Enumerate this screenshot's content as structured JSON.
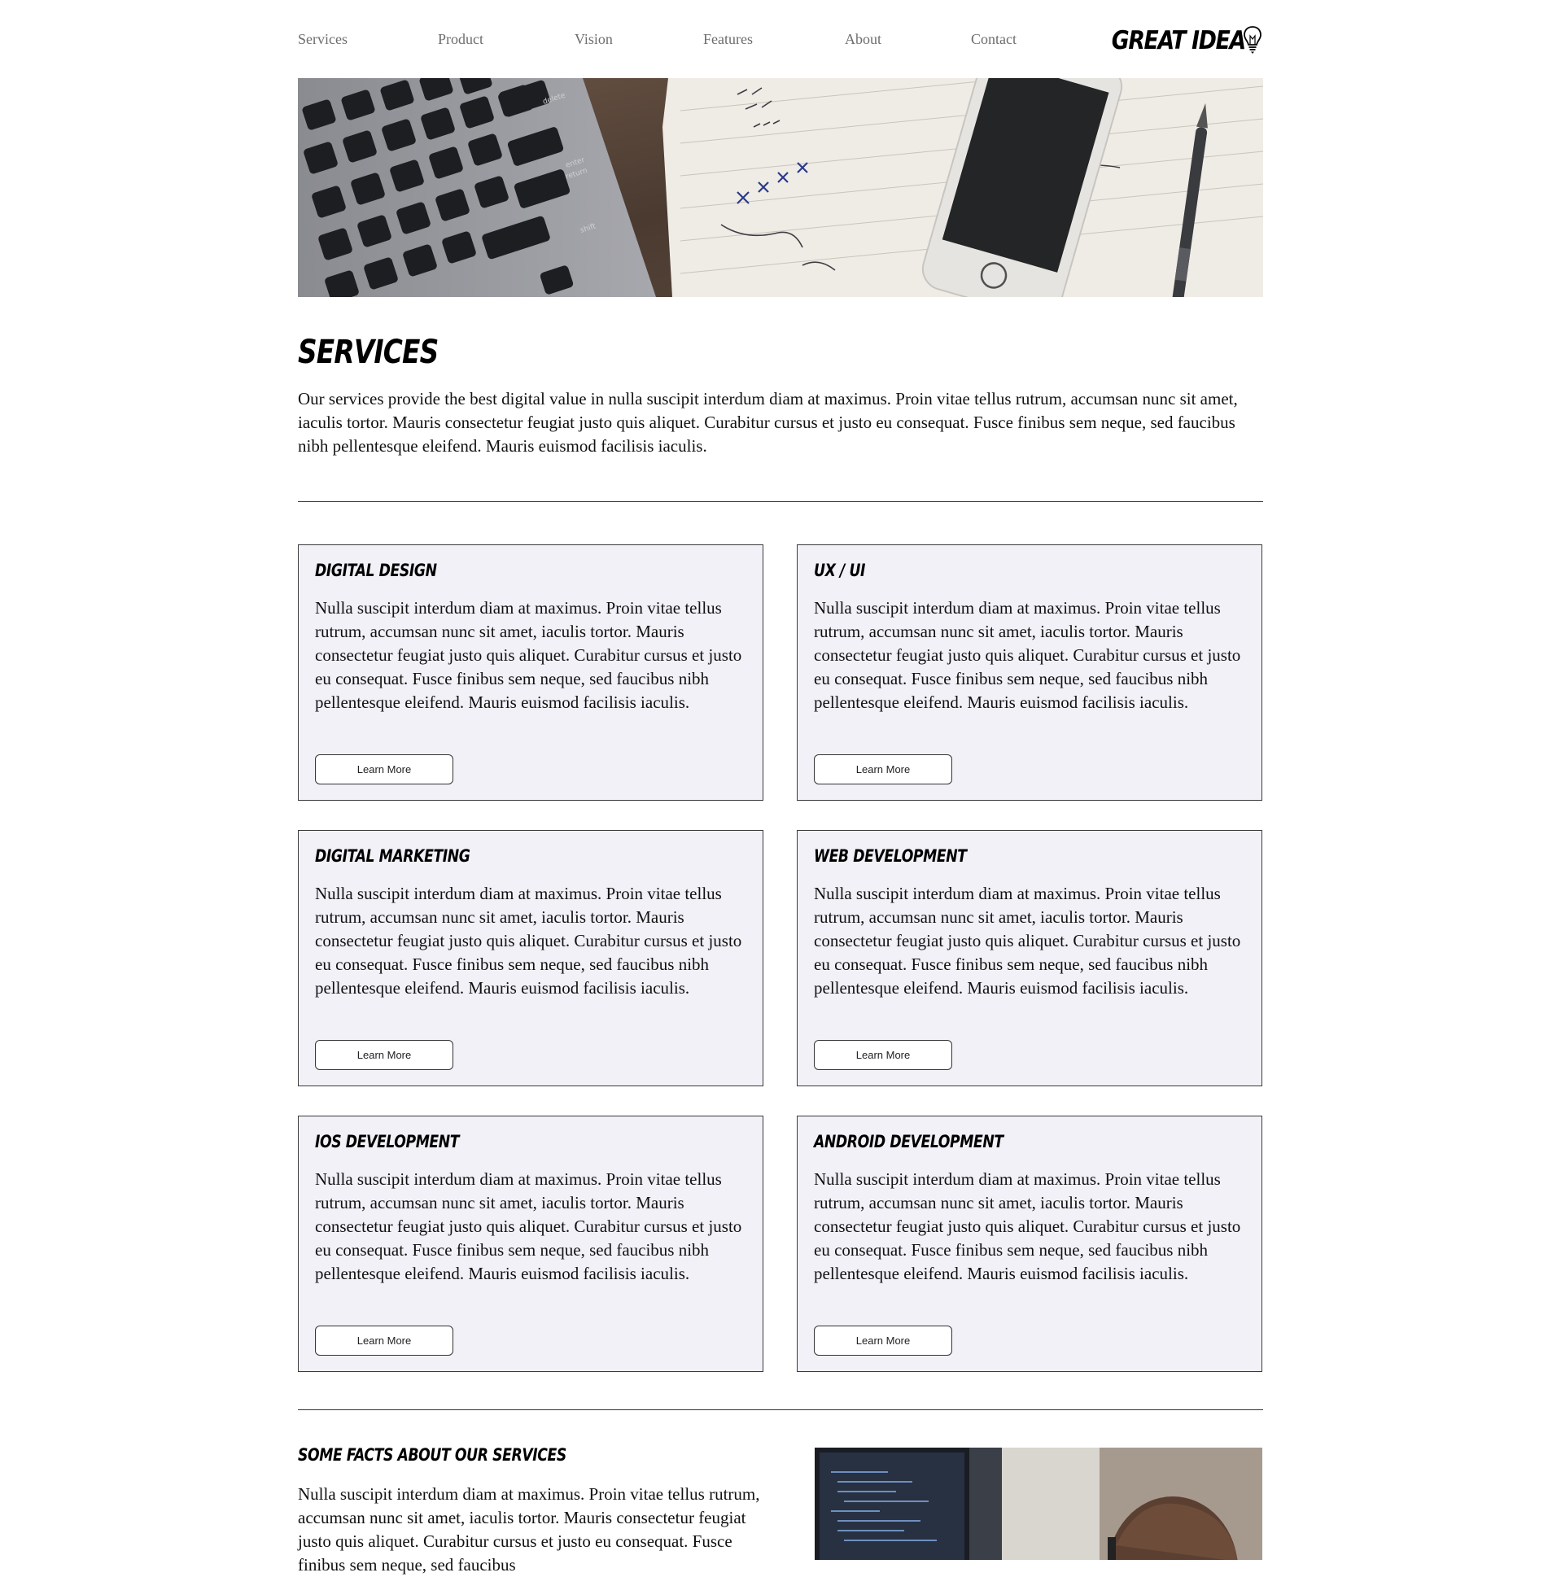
{
  "nav": {
    "items": [
      "Services",
      "Product",
      "Vision",
      "Features",
      "About",
      "Contact"
    ],
    "logo_text": "GREAT IDEA"
  },
  "hero": {
    "keyboard_keys": [
      "delete",
      "enter",
      "return",
      "shift"
    ]
  },
  "page": {
    "title": "SERVICES",
    "intro": "Our services provide the best digital value in nulla suscipit interdum diam at maximus. Proin vitae tellus rutrum, accumsan nunc sit amet, iaculis tortor. Mauris consectetur feugiat justo quis aliquet. Curabitur cursus et justo eu consequat. Fusce finibus sem neque, sed faucibus nibh pellentesque eleifend. Mauris euismod facilisis iaculis."
  },
  "cards": [
    {
      "title": "DIGITAL DESIGN",
      "text": "Nulla suscipit interdum diam at maximus. Proin vitae tellus rutrum, accumsan nunc sit amet, iaculis tortor. Mauris consectetur feugiat justo quis aliquet. Curabitur cursus et justo eu consequat. Fusce finibus sem neque, sed faucibus nibh pellentesque eleifend. Mauris euismod facilisis iaculis.",
      "button": "Learn More"
    },
    {
      "title": "UX / UI",
      "text": "Nulla suscipit interdum diam at maximus. Proin vitae tellus rutrum, accumsan nunc sit amet, iaculis tortor. Mauris consectetur feugiat justo quis aliquet. Curabitur cursus et justo eu consequat. Fusce finibus sem neque, sed faucibus nibh pellentesque eleifend. Mauris euismod facilisis iaculis.",
      "button": "Learn More"
    },
    {
      "title": "DIGITAL MARKETING",
      "text": "Nulla suscipit interdum diam at maximus. Proin vitae tellus rutrum, accumsan nunc sit amet, iaculis tortor. Mauris consectetur feugiat justo quis aliquet. Curabitur cursus et justo eu consequat. Fusce finibus sem neque, sed faucibus nibh pellentesque eleifend. Mauris euismod facilisis iaculis.",
      "button": "Learn More"
    },
    {
      "title": "WEB DEVELOPMENT",
      "text": "Nulla suscipit interdum diam at maximus. Proin vitae tellus rutrum, accumsan nunc sit amet, iaculis tortor. Mauris consectetur feugiat justo quis aliquet. Curabitur cursus et justo eu consequat. Fusce finibus sem neque, sed faucibus nibh pellentesque eleifend. Mauris euismod facilisis iaculis.",
      "button": "Learn More"
    },
    {
      "title": "IOS DEVELOPMENT",
      "text": "Nulla suscipit interdum diam at maximus. Proin vitae tellus rutrum, accumsan nunc sit amet, iaculis tortor. Mauris consectetur feugiat justo quis aliquet. Curabitur cursus et justo eu consequat. Fusce finibus sem neque, sed faucibus nibh pellentesque eleifend. Mauris euismod facilisis iaculis.",
      "button": "Learn More"
    },
    {
      "title": "ANDROID DEVELOPMENT",
      "text": "Nulla suscipit interdum diam at maximus. Proin vitae tellus rutrum, accumsan nunc sit amet, iaculis tortor. Mauris consectetur feugiat justo quis aliquet. Curabitur cursus et justo eu consequat. Fusce finibus sem neque, sed faucibus nibh pellentesque eleifend. Mauris euismod facilisis iaculis.",
      "button": "Learn More"
    }
  ],
  "facts": {
    "title": "SOME FACTS ABOUT OUR SERVICES",
    "text": "Nulla suscipit interdum diam at maximus. Proin vitae tellus rutrum, accumsan nunc sit amet, iaculis tortor. Mauris consectetur feugiat justo quis aliquet. Curabitur cursus et justo eu consequat. Fusce finibus sem neque, sed faucibus"
  },
  "colors": {
    "card_background": "#f2f1f8",
    "border": "#333333",
    "nav_text": "#6d6d6d",
    "text": "#111111"
  }
}
